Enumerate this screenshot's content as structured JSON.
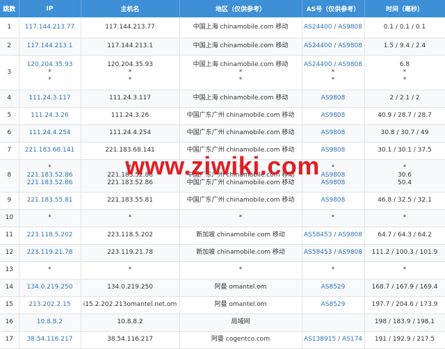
{
  "headers": [
    "跳数",
    "IP",
    "主机名",
    "地区（仅供参考）",
    "AS号（仅供参考）",
    "时间（毫秒）"
  ],
  "rows": [
    {
      "hop": "1",
      "h": 29,
      "ip": [
        "117.144.213.77"
      ],
      "host": [
        "117.144.213.77"
      ],
      "region": [
        "中国上海 chinamobile.com 移动"
      ],
      "as": [
        [
          "AS24400",
          "AS9808"
        ]
      ],
      "time": [
        "0.1 / 0.1 / 0.1"
      ]
    },
    {
      "hop": "2",
      "h": 25,
      "ip": [
        "117.144.213.1"
      ],
      "host": [
        "117.144.213.1"
      ],
      "region": [
        "中国上海 chinamobile.com 移动"
      ],
      "as": [
        [
          "AS24400",
          "AS9808"
        ]
      ],
      "time": [
        "1.5 / 9.4 / 2.4"
      ]
    },
    {
      "hop": "3",
      "h": 50,
      "ip": [
        "120.204.35.93",
        "*",
        "*"
      ],
      "host": [
        "120.204.35.93",
        "*",
        "*"
      ],
      "region": [
        "中国上海 chinamobile.com 移动",
        "*",
        "*"
      ],
      "as": [
        [
          "AS24400",
          "AS9808"
        ],
        [
          "*"
        ],
        [
          "*"
        ]
      ],
      "time": [
        "6.8",
        "*",
        "*"
      ]
    },
    {
      "hop": "4",
      "h": 25,
      "ip": [
        "111.24.3.117"
      ],
      "host": [
        "111.24.3.117"
      ],
      "region": [
        "中国上海 chinamobile.com 移动"
      ],
      "as": [
        [
          "AS9808"
        ]
      ],
      "time": [
        "2 / 2.1 / 2"
      ]
    },
    {
      "hop": "5",
      "h": 25,
      "ip": [
        "111.24.3.26"
      ],
      "host": [
        "111.24.3.26"
      ],
      "region": [
        "中国广东广州 chinamobile.com 移动"
      ],
      "as": [
        [
          "AS9808"
        ]
      ],
      "time": [
        "40.9 / 28.7 / 28.7"
      ]
    },
    {
      "hop": "6",
      "h": 25,
      "ip": [
        "111.24.4.254"
      ],
      "host": [
        "111.24.4.254"
      ],
      "region": [
        "中国广东广州 chinamobile.com 移动"
      ],
      "as": [
        [
          "AS9808"
        ]
      ],
      "time": [
        "30.8 / 30.7 / 49"
      ]
    },
    {
      "hop": "7",
      "h": 25,
      "ip": [
        "221.183.68.141"
      ],
      "host": [
        "221.183.68.141"
      ],
      "region": [
        "中国广东广州 chinamobile.com 移动"
      ],
      "as": [
        [
          "AS9808"
        ]
      ],
      "time": [
        "30.1 / 30.1 / 37.5"
      ]
    },
    {
      "hop": "8",
      "h": 47,
      "ip": [
        "*",
        "221.183.52.86",
        "221.183.52.86"
      ],
      "host": [
        "*",
        "221.183.52.86",
        "221.183.52.86"
      ],
      "region": [
        "*",
        "中国广东广州 chinamobile.com 移动",
        "中国广东广州 chinamobile.com 移动"
      ],
      "as": [
        [
          "*"
        ],
        [
          "AS9808"
        ],
        [
          "AS9808"
        ]
      ],
      "time": [
        "*",
        "30.6",
        "50.4"
      ]
    },
    {
      "hop": "9",
      "h": 25,
      "ip": [
        "221.183.55.81"
      ],
      "host": [
        "221.183.55.81"
      ],
      "region": [
        "中国广东广州 chinamobile.com 移动"
      ],
      "as": [
        [
          "AS9808"
        ]
      ],
      "time": [
        "46.8 / 32.5 / 32.1"
      ]
    },
    {
      "hop": "10",
      "h": 25,
      "ip": [
        "*"
      ],
      "host": [
        "*"
      ],
      "region": [
        "*"
      ],
      "as": [
        [
          "*"
        ]
      ],
      "time": [
        "*"
      ]
    },
    {
      "hop": "11",
      "h": 25,
      "ip": [
        "223.118.5.202"
      ],
      "host": [
        "223.118.5.202"
      ],
      "region": [
        "新加坡 chinamobile.com 移动"
      ],
      "as": [
        [
          "AS58453",
          "AS9808"
        ]
      ],
      "time": [
        "64.7 / 64.3 / 64.2"
      ]
    },
    {
      "hop": "12",
      "h": 25,
      "ip": [
        "223.119.21.78"
      ],
      "host": [
        "223.119.21.78"
      ],
      "region": [
        "新加坡 chinamobile.com 移动"
      ],
      "as": [
        [
          "AS58453",
          "AS9808"
        ]
      ],
      "time": [
        "111.2 / 100.3 / 101.9"
      ]
    },
    {
      "hop": "13",
      "h": 25,
      "ip": [
        "*"
      ],
      "host": [
        "*"
      ],
      "region": [
        "*"
      ],
      "as": [
        [
          "*"
        ]
      ],
      "time": [
        "*"
      ]
    },
    {
      "hop": "14",
      "h": 25,
      "ip": [
        "134.0.219.250"
      ],
      "host": [
        "134.0.219.250"
      ],
      "region": [
        "阿曼 omantel.om"
      ],
      "as": [
        [
          "AS8529"
        ]
      ],
      "time": [
        "168.7 / 167.9 / 169.4"
      ]
    },
    {
      "hop": "15",
      "h": 25,
      "ip": [
        "213.202.2.15"
      ],
      "host": [
        "i15.2.202.213omantel.net.om"
      ],
      "region": [
        "阿曼 omantel.om"
      ],
      "as": [
        [
          "AS8529"
        ]
      ],
      "time": [
        "197.7 / 204.6 / 173.9"
      ]
    },
    {
      "hop": "16",
      "h": 25,
      "ip": [
        "10.8.8.2"
      ],
      "host": [
        "10.8.8.2"
      ],
      "region": [
        "局域网"
      ],
      "as": [
        []
      ],
      "time": [
        "198 / 183.9 / 198.1"
      ]
    },
    {
      "hop": "17",
      "h": 25,
      "ip": [
        "38.54.116.217"
      ],
      "host": [
        "38.54.116.217"
      ],
      "region": [
        "阿曼 cogentco.com"
      ],
      "as": [
        [
          "AS138915",
          "AS174"
        ]
      ],
      "time": [
        "191 / 192.9 / 217.5"
      ]
    }
  ],
  "watermark": "www.ziwiki.com",
  "colors": {
    "header_bg": "#3d8fd6",
    "link": "#2e72b8",
    "watermark": "#e01e24"
  }
}
